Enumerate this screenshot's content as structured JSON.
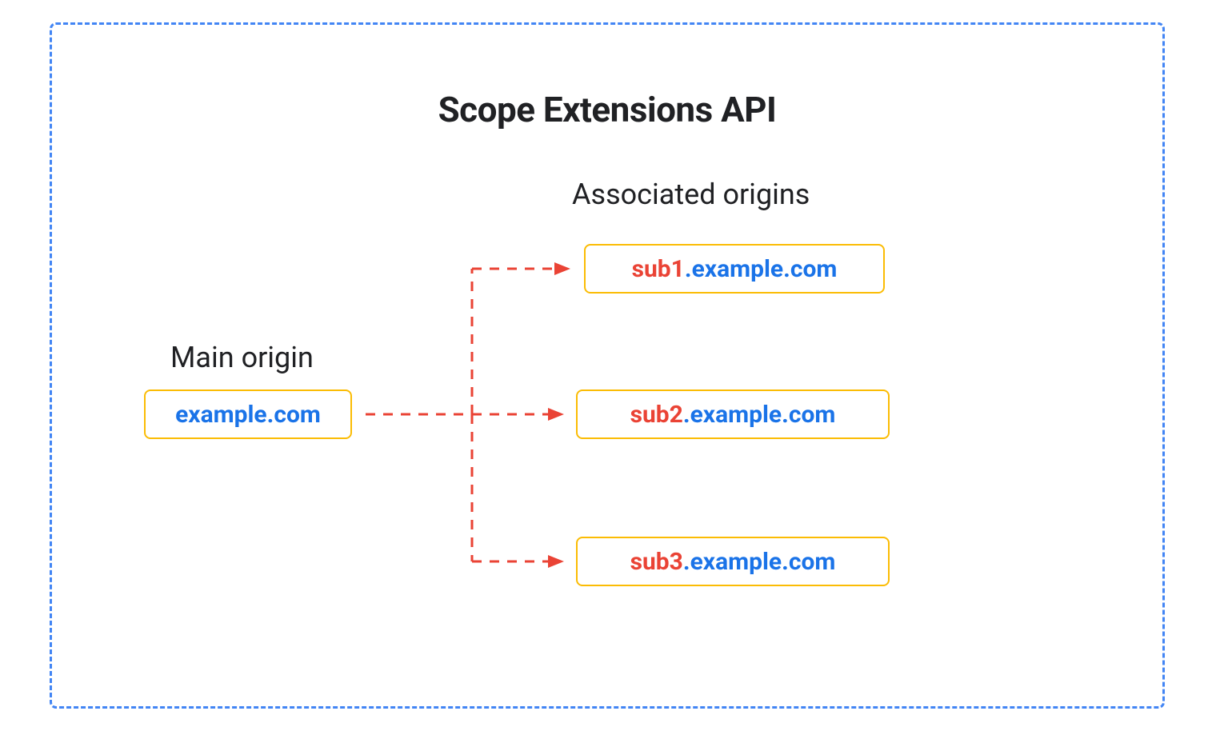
{
  "title": "Scope Extensions API",
  "mainOrigin": {
    "label": "Main origin",
    "domain": "example.com"
  },
  "associatedOrigins": {
    "label": "Associated origins",
    "items": [
      {
        "subdomain": "sub1",
        "domain": ".example.com"
      },
      {
        "subdomain": "sub2",
        "domain": ".example.com"
      },
      {
        "subdomain": "sub3",
        "domain": ".example.com"
      }
    ]
  },
  "colors": {
    "borderBlue": "#4285f4",
    "boxBorder": "#fbbc04",
    "textBlue": "#1a73e8",
    "textRed": "#ea4335",
    "textDark": "#202124"
  }
}
